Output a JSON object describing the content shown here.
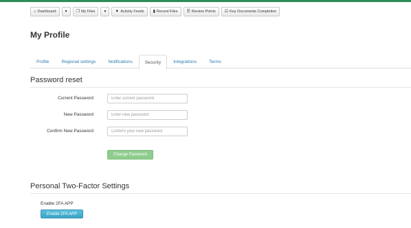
{
  "toolbar": {
    "dashboard": {
      "label": "Dashboard",
      "icon": "home-icon"
    },
    "my_files": {
      "label": "My Files",
      "icon": "files-icon"
    },
    "activity_feeds": {
      "label": "Activity Feeds",
      "icon": "filter-icon"
    },
    "recent_files": {
      "label": "Recent Files",
      "icon": "file-icon"
    },
    "review_points": {
      "label": "Review Points",
      "icon": "list-icon"
    },
    "key_docs": {
      "label": "Key Documents Completion",
      "icon": "check-icon"
    },
    "caret": "▼"
  },
  "page": {
    "title": "My Profile"
  },
  "tabs": [
    {
      "label": "Profile",
      "active": false
    },
    {
      "label": "Regional settings",
      "active": false
    },
    {
      "label": "Notifications",
      "active": false
    },
    {
      "label": "Security",
      "active": true
    },
    {
      "label": "Integrations",
      "active": false
    },
    {
      "label": "Terms",
      "active": false
    }
  ],
  "password_reset": {
    "title": "Password reset",
    "current": {
      "label": "Current Password",
      "placeholder": "Enter current password",
      "value": ""
    },
    "new": {
      "label": "New Password",
      "placeholder": "Enter new password",
      "value": ""
    },
    "confirm": {
      "label": "Confirm New Password",
      "placeholder": "Confirm your new password",
      "value": ""
    },
    "submit_label": "Change Password"
  },
  "two_factor": {
    "title": "Personal Two-Factor Settings",
    "app_label": "Enable 2FA APP",
    "button_label": "Enable 2FA APP"
  },
  "colors": {
    "accent_strip": "#2e8b57",
    "link": "#2a7ab0",
    "success_button": "#8fcc8f",
    "info_button": "#5bc0de"
  }
}
